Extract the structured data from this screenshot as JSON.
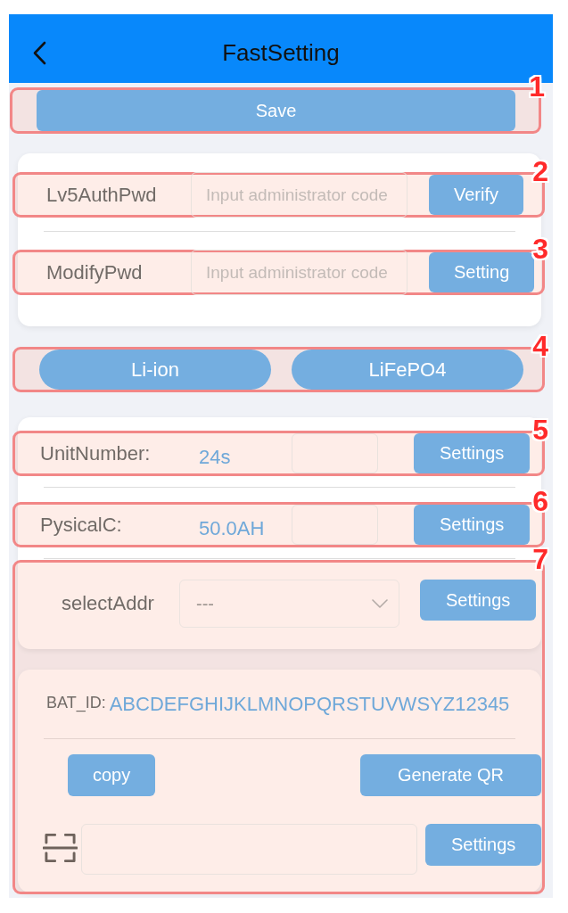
{
  "header": {
    "title": "FastSetting"
  },
  "save": {
    "callout": "1",
    "button": "Save"
  },
  "password_card": {
    "rows": [
      {
        "callout": "2",
        "label": "Lv5AuthPwd",
        "placeholder": "Input administrator code",
        "button": "Verify"
      },
      {
        "callout": "3",
        "label": "ModifyPwd",
        "placeholder": "Input administrator code",
        "button": "Setting"
      }
    ]
  },
  "battery_type": {
    "callout": "4",
    "options": [
      {
        "label": "Li-ion"
      },
      {
        "label": "LiFePO4"
      }
    ]
  },
  "parameter_card": {
    "rows": [
      {
        "callout": "5",
        "label": "UnitNumber:",
        "value": "24s",
        "button": "Settings"
      },
      {
        "callout": "6",
        "label": "PysicalC:",
        "value": "50.0AH",
        "button": "Settings"
      }
    ]
  },
  "address_section": {
    "callout": "7",
    "select": {
      "label": "selectAddr",
      "value": "---",
      "button": "Settings"
    },
    "battery_id": {
      "label": "BAT_ID:",
      "value": "ABCDEFGHIJKLMNOPQRSTUVWSYZ12345",
      "copy_button": "copy",
      "qr_button": "Generate QR",
      "scan_button": "Settings"
    }
  }
}
